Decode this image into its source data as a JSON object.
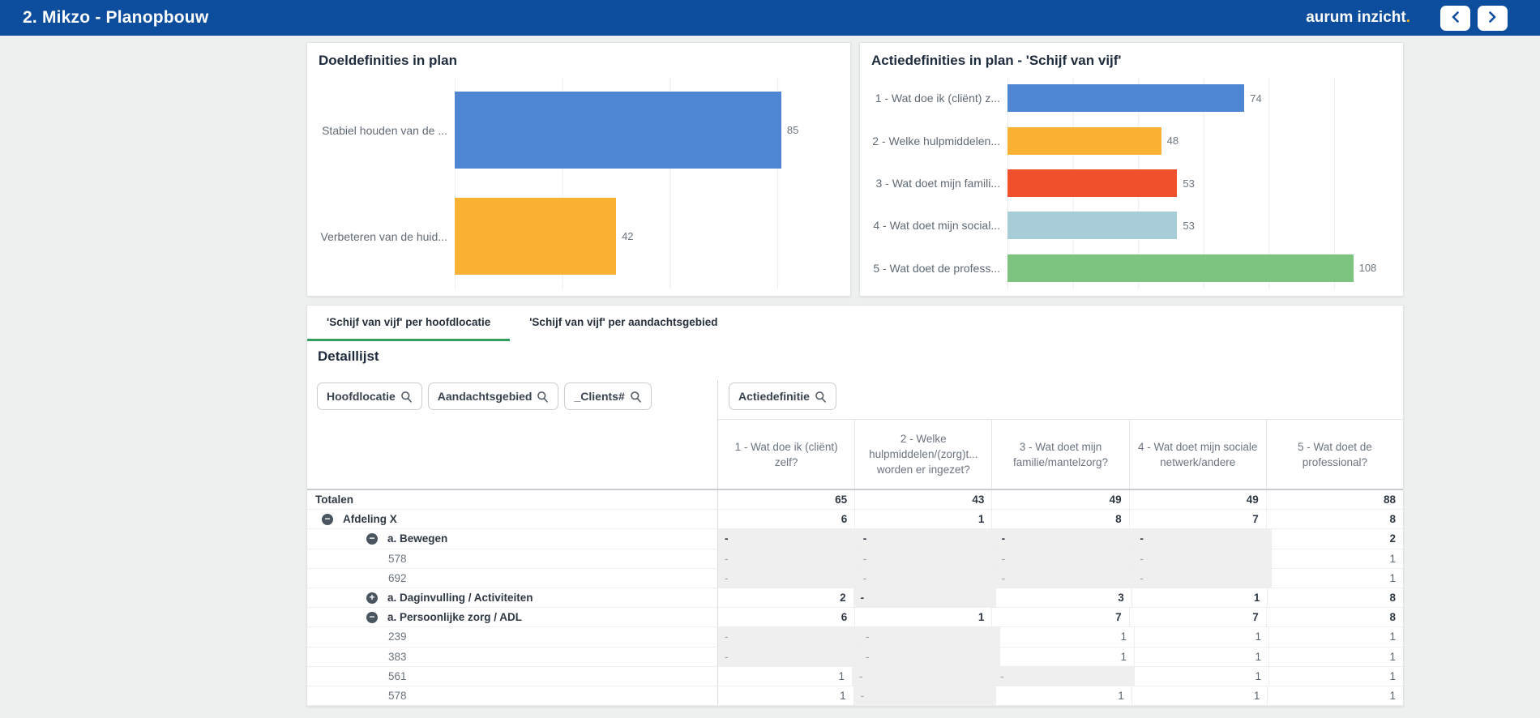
{
  "header": {
    "title": "2. Mikzo - Planopbouw",
    "brand": "aurum inzicht",
    "brand_dot": ".",
    "bg_color": "#0d4d9d",
    "accent_dot_color": "#f2a71b",
    "icons": {
      "prev": "chevron-left-icon",
      "next": "chevron-right-icon"
    }
  },
  "chart_data": [
    {
      "type": "bar",
      "orientation": "horizontal",
      "title": "Doeldefinities in plan",
      "categories": [
        "Stabiel houden van de ...",
        "Verbeteren van de huid..."
      ],
      "values": [
        85,
        42
      ],
      "colors": [
        "#4e86d4",
        "#f9b234"
      ],
      "xlabel": "",
      "ylabel": "",
      "xlim": [
        0,
        100
      ],
      "grid": true,
      "value_labels": true
    },
    {
      "type": "bar",
      "orientation": "horizontal",
      "title": "Actiedefinities in plan - 'Schijf van vijf'",
      "categories": [
        "1 - Wat doe ik (cliënt) z...",
        "2 - Welke hulpmiddelen...",
        "3 - Wat doet mijn famili...",
        "4 - Wat doet mijn social...",
        "5 - Wat doet de profess..."
      ],
      "values": [
        74,
        48,
        53,
        53,
        108
      ],
      "colors": [
        "#4e86d4",
        "#f9b234",
        "#f0512c",
        "#a7ced8",
        "#7cc47f"
      ],
      "xlabel": "",
      "ylabel": "",
      "xlim": [
        0,
        120
      ],
      "grid": true,
      "value_labels": true
    }
  ],
  "tabs": {
    "active_underline_color": "#2f9e5f",
    "items": [
      {
        "label": "'Schijf van vijf' per hoofdlocatie",
        "active": true
      },
      {
        "label": "'Schijf van vijf' per aandachtsgebied",
        "active": false
      }
    ]
  },
  "detail": {
    "title": "Detaillijst",
    "filters_left": [
      "Hoofdlocatie",
      "Aandachtsgebied",
      "_Clients#"
    ],
    "filters_right": [
      "Actiedefinitie"
    ],
    "filter_icon": "search-icon",
    "columns": [
      "1 - Wat doe ik (cliënt) zelf?",
      "2 - Welke hulpmiddelen/(zorg)t... worden er ingezet?",
      "3 - Wat doet mijn familie/mantelzorg?",
      "4 - Wat doet mijn sociale netwerk/andere",
      "5 - Wat doet de professional?"
    ],
    "rows": [
      {
        "label": "Totalen",
        "level": 0,
        "icon": "",
        "bold": true,
        "values": [
          "65",
          "43",
          "49",
          "49",
          "88"
        ]
      },
      {
        "label": "Afdeling X",
        "level": 1,
        "icon": "minus",
        "bold": true,
        "values": [
          "6",
          "1",
          "8",
          "7",
          "8"
        ]
      },
      {
        "label": "a. Bewegen",
        "level": 2,
        "icon": "minus",
        "bold": true,
        "values": [
          "-",
          "-",
          "-",
          "-",
          "2"
        ]
      },
      {
        "label": "578",
        "level": 3,
        "icon": "",
        "bold": false,
        "values": [
          "-",
          "-",
          "-",
          "-",
          "1"
        ]
      },
      {
        "label": "692",
        "level": 3,
        "icon": "",
        "bold": false,
        "values": [
          "-",
          "-",
          "-",
          "-",
          "1"
        ]
      },
      {
        "label": "a. Daginvulling / Activiteiten",
        "level": 2,
        "icon": "plus",
        "bold": true,
        "values": [
          "2",
          "-",
          "3",
          "1",
          "8"
        ]
      },
      {
        "label": "a. Persoonlijke zorg / ADL",
        "level": 2,
        "icon": "minus",
        "bold": true,
        "values": [
          "6",
          "1",
          "7",
          "7",
          "8"
        ]
      },
      {
        "label": "239",
        "level": 3,
        "icon": "",
        "bold": false,
        "values": [
          "-",
          "-",
          "1",
          "1",
          "1"
        ]
      },
      {
        "label": "383",
        "level": 3,
        "icon": "",
        "bold": false,
        "values": [
          "-",
          "-",
          "1",
          "1",
          "1"
        ]
      },
      {
        "label": "561",
        "level": 3,
        "icon": "",
        "bold": false,
        "values": [
          "1",
          "-",
          "-",
          "1",
          "1"
        ]
      },
      {
        "label": "578",
        "level": 3,
        "icon": "",
        "bold": false,
        "values": [
          "1",
          "-",
          "1",
          "1",
          "1"
        ]
      }
    ]
  }
}
